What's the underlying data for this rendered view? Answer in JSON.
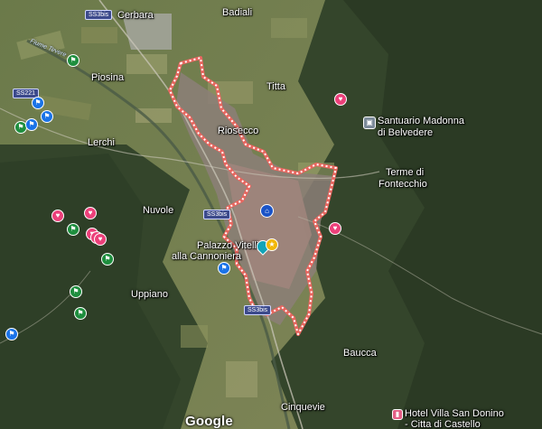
{
  "map": {
    "attribution": "Google",
    "places": [
      {
        "id": "cerbara",
        "name": "Cerbara"
      },
      {
        "id": "badiali",
        "name": "Badiali"
      },
      {
        "id": "piosina",
        "name": "Piosina"
      },
      {
        "id": "titta",
        "name": "Titta"
      },
      {
        "id": "riosecco",
        "name": "Riosecco"
      },
      {
        "id": "lerchi",
        "name": "Lerchi"
      },
      {
        "id": "nuvole",
        "name": "Nuvole"
      },
      {
        "id": "uppiano",
        "name": "Uppiano"
      },
      {
        "id": "terme-1",
        "name": "Terme di"
      },
      {
        "id": "terme-2",
        "name": "Fontecchio"
      },
      {
        "id": "santuario-1",
        "name": "Santuario Madonna"
      },
      {
        "id": "santuario-2",
        "name": "di Belvedere"
      },
      {
        "id": "palazzo-1",
        "name": "Palazzo Vitelli"
      },
      {
        "id": "palazzo-2",
        "name": "alla Cannoniera"
      },
      {
        "id": "baucca",
        "name": "Baucca"
      },
      {
        "id": "cinquevie",
        "name": "Cinquevie"
      },
      {
        "id": "hotel-1",
        "name": "Hotel Villa San Donino"
      },
      {
        "id": "hotel-2",
        "name": "- Citta di Castello"
      }
    ],
    "roads": [
      {
        "id": "ss3bis-top",
        "name": "SS3bis"
      },
      {
        "id": "ss221",
        "name": "SS221"
      },
      {
        "id": "ss3bis-mid",
        "name": "SS3bis"
      },
      {
        "id": "ss3bis-low",
        "name": "SS3bis"
      }
    ],
    "river": "Fiume Tevere",
    "markers": [
      {
        "id": "m1",
        "color": "green",
        "icon": "flag-icon"
      },
      {
        "id": "m2",
        "color": "blue",
        "icon": "flag-icon"
      },
      {
        "id": "m3",
        "color": "blue",
        "icon": "flag-icon"
      },
      {
        "id": "m4",
        "color": "green",
        "icon": "flag-icon"
      },
      {
        "id": "m5",
        "color": "blue",
        "icon": "flag-icon"
      },
      {
        "id": "m6",
        "color": "pink",
        "icon": "heart-icon"
      },
      {
        "id": "m7",
        "color": "pink",
        "icon": "heart-icon"
      },
      {
        "id": "m8",
        "color": "green",
        "icon": "flag-icon"
      },
      {
        "id": "m9",
        "color": "pink",
        "icon": "heart-icon"
      },
      {
        "id": "m10",
        "color": "pink",
        "icon": "heart-icon"
      },
      {
        "id": "m11",
        "color": "pink",
        "icon": "heart-icon"
      },
      {
        "id": "m12",
        "color": "green",
        "icon": "flag-icon"
      },
      {
        "id": "m13",
        "color": "green",
        "icon": "flag-icon"
      },
      {
        "id": "m14",
        "color": "green",
        "icon": "flag-icon"
      },
      {
        "id": "m15",
        "color": "blue",
        "icon": "flag-icon"
      },
      {
        "id": "m16",
        "color": "blue",
        "icon": "flag-icon"
      },
      {
        "id": "m17",
        "color": "pink",
        "icon": "heart-icon"
      },
      {
        "id": "m18",
        "color": "pink",
        "icon": "heart-icon"
      },
      {
        "id": "m19",
        "color": "navy",
        "icon": "home-icon"
      },
      {
        "id": "m20",
        "color": "teal",
        "icon": "place-pin-icon"
      },
      {
        "id": "m21",
        "color": "gold",
        "icon": "star-icon"
      },
      {
        "id": "m22",
        "color": "grey",
        "icon": "building-icon"
      },
      {
        "id": "m23",
        "color": "rose",
        "icon": "hotel-icon"
      }
    ],
    "colors": {
      "boundary_outline": "#e8665f",
      "boundary_dash": "#ffffff",
      "label_text": "#ffffff"
    }
  }
}
